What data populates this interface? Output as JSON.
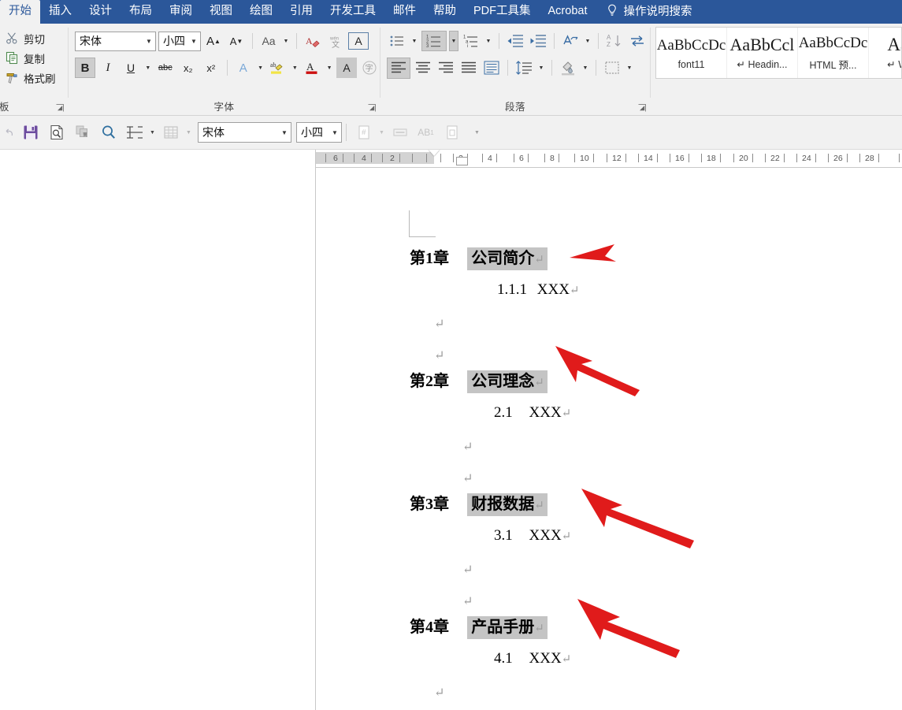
{
  "ribbon": {
    "tabs": [
      {
        "label": "开始",
        "active": true
      },
      {
        "label": "插入",
        "active": false
      },
      {
        "label": "设计",
        "active": false
      },
      {
        "label": "布局",
        "active": false
      },
      {
        "label": "审阅",
        "active": false
      },
      {
        "label": "视图",
        "active": false
      },
      {
        "label": "绘图",
        "active": false
      },
      {
        "label": "引用",
        "active": false
      },
      {
        "label": "开发工具",
        "active": false
      },
      {
        "label": "邮件",
        "active": false
      },
      {
        "label": "帮助",
        "active": false
      },
      {
        "label": "PDF工具集",
        "active": false
      },
      {
        "label": "Acrobat",
        "active": false
      }
    ],
    "tell_me": "操作说明搜索",
    "accent_color": "#2b579a"
  },
  "clipboard_group": {
    "label": "剪贴板",
    "label_visible": "占板",
    "items": [
      {
        "label": "剪切",
        "icon": "scissors-icon"
      },
      {
        "label": "复制",
        "icon": "copy-icon"
      },
      {
        "label": "格式刷",
        "icon": "format-painter-icon"
      }
    ]
  },
  "font_group": {
    "label": "字体",
    "font_name": "宋体",
    "font_size": "小四",
    "bold_label": "B",
    "italic_label": "I",
    "underline_label": "U",
    "strikethrough_label": "abc",
    "subscript_label": "x₂",
    "superscript_label": "x²",
    "grow_font_label": "A",
    "shrink_font_label": "A",
    "change_case_label": "Aa",
    "text_effects_label": "A",
    "highlight_label": "ab",
    "font_color_label": "A",
    "char_shading_label": "A",
    "enclose_char_label": "字",
    "phonetic_label": "文",
    "bold_active": true
  },
  "paragraph_group": {
    "label": "段落",
    "numbered_list_active": true,
    "align_left_active": true
  },
  "styles_group": {
    "cards": [
      {
        "preview": "AaBbCcDc",
        "name": "font11"
      },
      {
        "preview": "AaBbCcl",
        "name": "↵ Headin..."
      },
      {
        "preview": "AaBbCcDc",
        "name": "HTML 预..."
      },
      {
        "preview": "AaB",
        "name": "↵ WPS"
      }
    ]
  },
  "toolbar2": {
    "font_name": "宋体",
    "font_size": "小四",
    "buttons": [
      {
        "name": "save-icon",
        "enabled": true
      },
      {
        "name": "print-preview-icon",
        "enabled": true
      },
      {
        "name": "copy-icon",
        "enabled": false
      },
      {
        "name": "search-icon",
        "enabled": true
      },
      {
        "name": "split-icon",
        "enabled": true
      },
      {
        "name": "table-icon",
        "enabled": false
      }
    ],
    "right_buttons": [
      {
        "name": "page-number-icon",
        "enabled": false
      },
      {
        "name": "header-icon",
        "enabled": false
      },
      {
        "name": "footnote-icon",
        "label": "AB",
        "enabled": false
      },
      {
        "name": "page-setup-icon",
        "enabled": false
      }
    ]
  },
  "ruler": {
    "margin_ticks": [
      "6",
      "4",
      "2"
    ],
    "body_ticks": [
      "2",
      "4",
      "6",
      "8",
      "10",
      "12",
      "14",
      "16",
      "18",
      "20",
      "22",
      "24",
      "26",
      "28"
    ]
  },
  "document": {
    "highlight_color": "#c4c4c4",
    "arrow_color": "#e01b1b",
    "paragraph_mark": "↵",
    "blocks": [
      {
        "chapter": "第1章",
        "title": "公司简介",
        "subheading_number": "1.1.1",
        "subheading_text": "XXX",
        "has_arrow": true
      },
      {
        "chapter": "第2章",
        "title": "公司理念",
        "subheading_number": "2.1",
        "subheading_text": "XXX",
        "has_arrow": true
      },
      {
        "chapter": "第3章",
        "title": "财报数据",
        "subheading_number": "3.1",
        "subheading_text": "XXX",
        "has_arrow": true
      },
      {
        "chapter": "第4章",
        "title": "产品手册",
        "subheading_number": "4.1",
        "subheading_text": "XXX",
        "has_arrow": true
      }
    ]
  }
}
